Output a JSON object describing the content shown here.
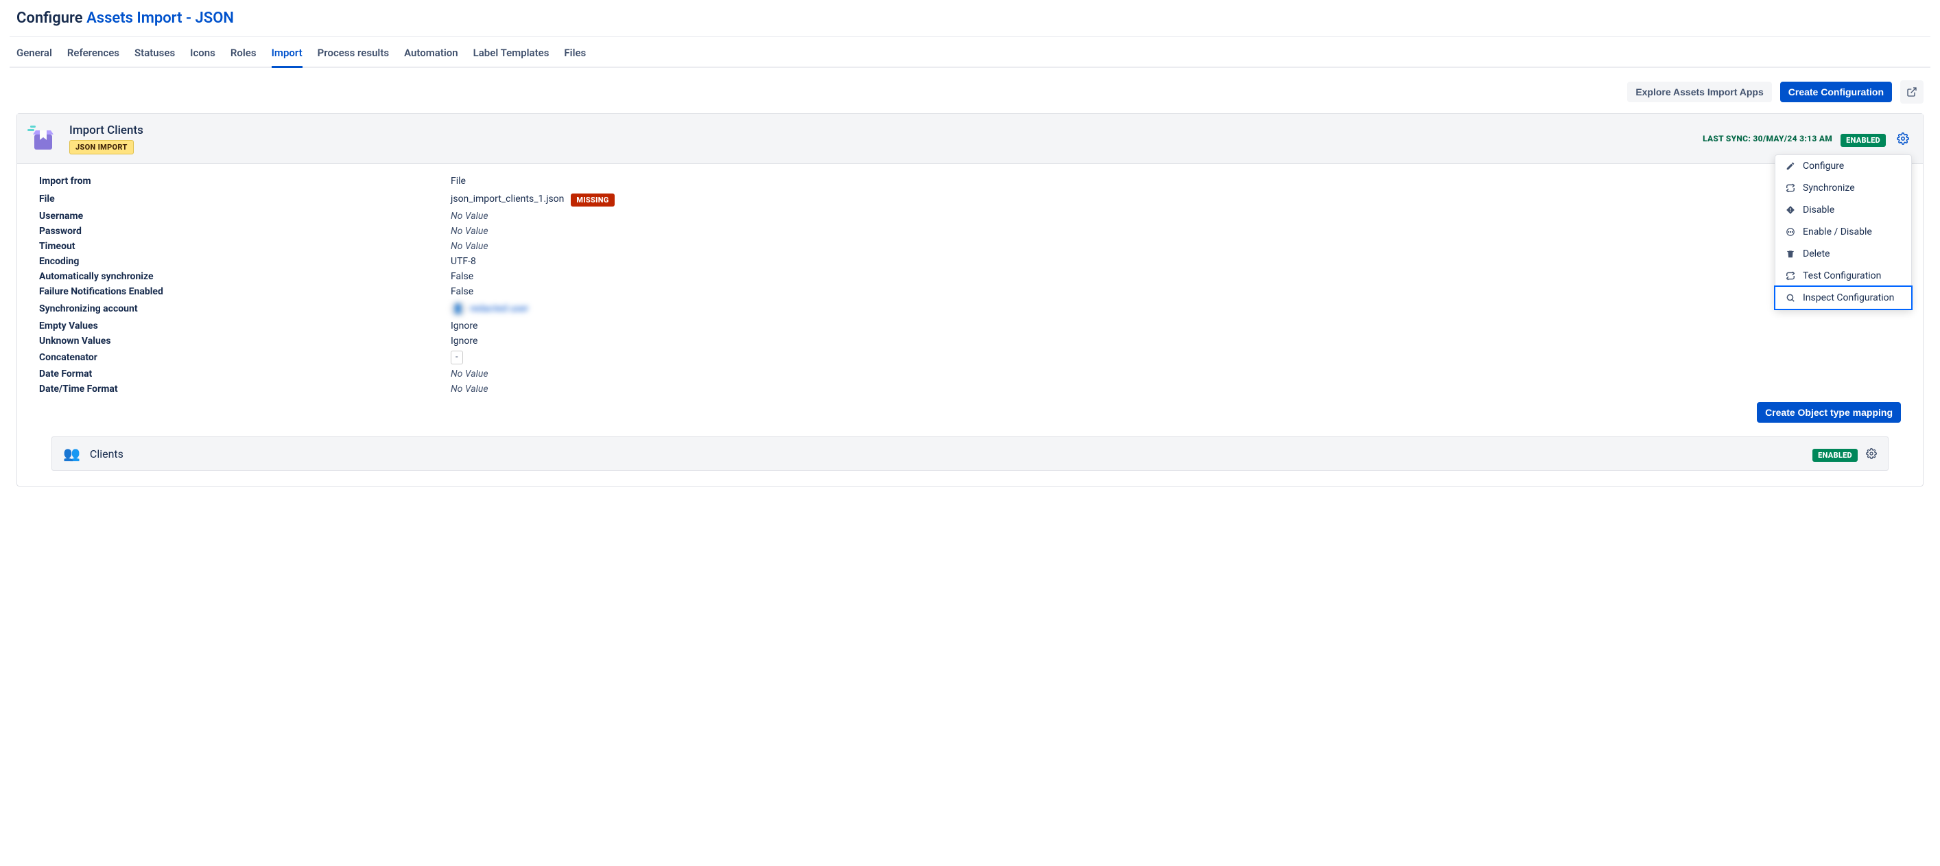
{
  "header": {
    "title_static": "Configure",
    "title_link": "Assets Import - JSON"
  },
  "tabs": [
    "General",
    "References",
    "Statuses",
    "Icons",
    "Roles",
    "Import",
    "Process results",
    "Automation",
    "Label Templates",
    "Files"
  ],
  "active_tab_index": 5,
  "actions": {
    "explore": "Explore Assets Import Apps",
    "create_config": "Create Configuration"
  },
  "panel": {
    "title": "Import Clients",
    "type_badge": "JSON IMPORT",
    "last_sync_label": "LAST SYNC: 30/MAY/24 3:13 AM",
    "status_badge": "ENABLED",
    "menu": [
      "Configure",
      "Synchronize",
      "Disable",
      "Enable / Disable",
      "Delete",
      "Test Configuration",
      "Inspect Configuration"
    ],
    "create_mapping": "Create Object type mapping"
  },
  "details": {
    "labels": {
      "import_from": "Import from",
      "file": "File",
      "username": "Username",
      "password": "Password",
      "timeout": "Timeout",
      "encoding": "Encoding",
      "auto_sync": "Automatically synchronize",
      "failure_notif": "Failure Notifications Enabled",
      "sync_account": "Synchronizing account",
      "empty_values": "Empty Values",
      "unknown_values": "Unknown Values",
      "concatenator": "Concatenator",
      "date_format": "Date Format",
      "datetime_format": "Date/Time Format"
    },
    "values": {
      "import_from": "File",
      "file": "json_import_clients_1.json",
      "file_badge": "MISSING",
      "username": "No Value",
      "password": "No Value",
      "timeout": "No Value",
      "encoding": "UTF-8",
      "auto_sync": "False",
      "failure_notif": "False",
      "sync_account": "redacted user",
      "empty_values": "Ignore",
      "unknown_values": "Ignore",
      "concatenator": "-",
      "date_format": "No Value",
      "datetime_format": "No Value"
    }
  },
  "sub_panel": {
    "title": "Clients",
    "status_badge": "ENABLED"
  }
}
